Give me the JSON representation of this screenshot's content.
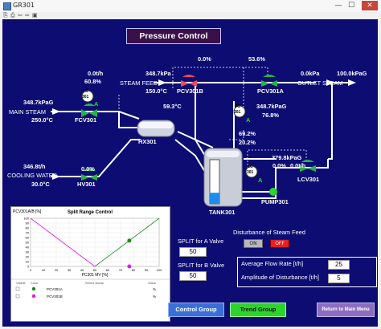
{
  "window": {
    "title": "GR301",
    "toolbar": [
      "⎘",
      "⎙",
      "⇦",
      "⇨",
      "▣"
    ],
    "controls": {
      "minimize": "—",
      "maximize": "☐",
      "close": "✕"
    }
  },
  "header": {
    "title": "Pressure Control"
  },
  "labels": {
    "steam_flow": "0.0t/h",
    "steam_pct": "60.8%",
    "pcv301b_pct": "0.0%",
    "pcv301a_pct": "53.6%",
    "steam_feed_pressure": "348.7kPa",
    "steam_feed": "STEAM FEED",
    "steam_feed_temp": "150.0°C",
    "pcv301b": "PCV301B",
    "pcv301a": "PCV301A",
    "outlet_flow": "0.0kPa",
    "outlet_steam": "OUTLET STEAM",
    "outlet_pressure": "100.0kPaG",
    "main_steam_pressure": "348.7kPaG",
    "main_steam": "MAIN STEAM",
    "main_steam_temp": "250.0°C",
    "fc_top": "FC",
    "fc_num": "301",
    "fc_mode": "A",
    "fcv301": "FCV301",
    "pc_top": "PC",
    "pc_num": "301",
    "pc_mode": "A",
    "pc_pressure": "348.7kPaG",
    "pc_pct": "76.8%",
    "hx_temp": "59.3°C",
    "hx301": "HX301",
    "lc_pct1": "69.2%",
    "lc_pct2": "20.2%",
    "lc_top": "LC",
    "lc_num": "301",
    "lc_mode": "A",
    "pump_pressure": "379.8kPaG",
    "pump_flow": "0.0t/h",
    "lcv_pct": "0.0%",
    "lcv301": "LCV301",
    "pump301": "PUMP301",
    "tank301": "TANK301",
    "cw_flow": "346.8t/h",
    "cooling_water": "COOLING WATER",
    "cw_temp": "30.0°C",
    "hv301": "HV301",
    "hv_pct": "0.0%"
  },
  "tank": {
    "level": 0.25
  },
  "split": {
    "a_label": "SPLIT for A Valve",
    "a_value": "50",
    "b_label": "SPLIT for B Valve",
    "b_value": "50"
  },
  "disturbance": {
    "title": "Disturbance of Steam Feed",
    "on_label": "ON",
    "off_label": "OFF",
    "avg_label": "Average Flow Rate [t/h]",
    "avg_value": "25",
    "amp_label": "Amplitude of Disturbance [t/h]",
    "amp_value": "5"
  },
  "buttons": {
    "control_group": "Control Group",
    "trend_group": "Trend Group",
    "return_main": "Return to Main Menu"
  },
  "chart_data": {
    "type": "line",
    "title": "Split Range Control",
    "ylabel": "PCV301A/B [%]",
    "xlabel": "PC301 MV [%]",
    "xlim": [
      0,
      100
    ],
    "ylim": [
      0,
      100
    ],
    "x_ticks": [
      0,
      10,
      20,
      30,
      40,
      50,
      60,
      70,
      80,
      90,
      100
    ],
    "y_ticks": [
      0,
      10,
      20,
      30,
      40,
      50,
      60,
      70,
      80,
      90,
      100
    ],
    "series": [
      {
        "name": "PCV301A",
        "color": "#1a8c1a",
        "values": [
          [
            50,
            0
          ],
          [
            100,
            100
          ]
        ],
        "marker": [
          76.8,
          53.6
        ],
        "unit": "%"
      },
      {
        "name": "PCV301B",
        "color": "#e619e6",
        "values": [
          [
            0,
            100
          ],
          [
            50,
            0
          ]
        ],
        "marker": [
          76.8,
          0
        ],
        "unit": "%"
      }
    ],
    "legend_headers": [
      "Visible",
      "Color",
      "Series Name",
      "Value"
    ]
  }
}
